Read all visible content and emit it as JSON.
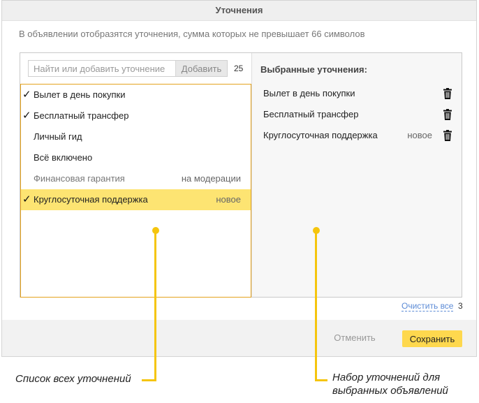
{
  "dialog": {
    "title": "Уточнения",
    "hint": "В объявлении отобразятся уточнения, сумма которых не превышает 66 символов"
  },
  "search": {
    "placeholder": "Найти или добавить уточнение",
    "value": "",
    "add_label": "Добавить",
    "counter": "25"
  },
  "list": {
    "items": [
      {
        "label": "Вылет в день покупки",
        "checked": true,
        "status": ""
      },
      {
        "label": "Бесплатный трансфер",
        "checked": true,
        "status": ""
      },
      {
        "label": "Личный гид",
        "checked": false,
        "status": ""
      },
      {
        "label": "Всё включено",
        "checked": false,
        "status": ""
      },
      {
        "label": "Финансовая гарантия",
        "checked": false,
        "status": "на модерации"
      },
      {
        "label": "Круглосуточная поддержка",
        "checked": true,
        "status": "новое"
      }
    ],
    "check_glyph": "✓"
  },
  "selected": {
    "title": "Выбранные уточнения:",
    "items": [
      {
        "label": "Вылет в день покупки",
        "status": ""
      },
      {
        "label": "Бесплатный трансфер",
        "status": ""
      },
      {
        "label": "Круглосуточная поддержка",
        "status": "новое"
      }
    ]
  },
  "footer_links": {
    "clear_all": "Очистить все",
    "clear_count": "3"
  },
  "footer": {
    "cancel": "Отменить",
    "save": "Сохранить"
  },
  "annotations": {
    "left_caption": "Список всех уточнений",
    "right_caption_line1": "Набор уточнений для",
    "right_caption_line2": "выбранных объявлений"
  },
  "colors": {
    "accent": "#fed84e",
    "highlight_row": "#fde472",
    "annotation": "#f5c50d",
    "list_border": "#e4a21d",
    "link": "#5c8bd6"
  }
}
